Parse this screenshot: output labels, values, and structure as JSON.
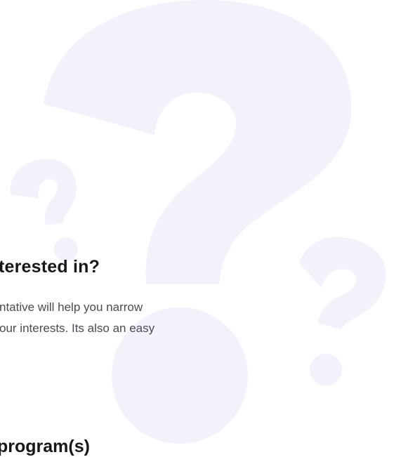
{
  "section_question": {
    "heading": "terested in?",
    "description_line_1": "ntative will help you narrow",
    "description_line_2": "our interests. Its also an easy"
  },
  "section_next": {
    "heading": "program(s)"
  },
  "background": {
    "art_icon": "question-marks-watermark",
    "art_color": "#f2f2fa"
  }
}
